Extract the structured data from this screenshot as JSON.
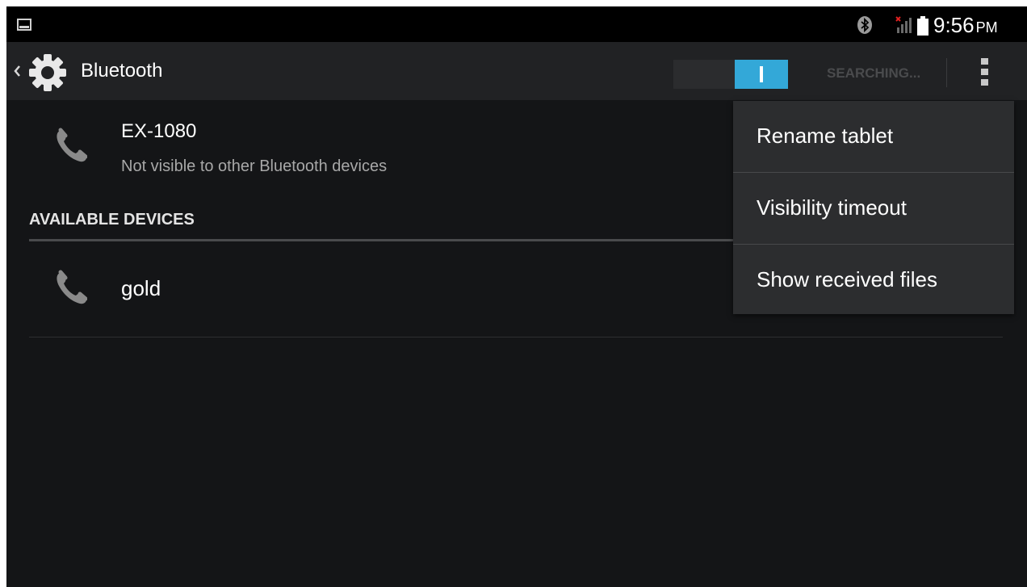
{
  "status_bar": {
    "time": "9:56",
    "ampm": "PM",
    "icons": [
      "picture-icon",
      "bluetooth-icon",
      "signal-icon",
      "battery-icon"
    ]
  },
  "action_bar": {
    "title": "Bluetooth",
    "toggle_on": true,
    "searching_label": "SEARCHING...",
    "toggle_color": "#33a8d8"
  },
  "paired_device": {
    "name": "EX-1080",
    "subtitle": "Not visible to other Bluetooth devices",
    "icon": "phone-icon"
  },
  "available": {
    "header": "AVAILABLE DEVICES",
    "devices": [
      {
        "name": "gold",
        "icon": "phone-icon"
      }
    ]
  },
  "overflow_menu": {
    "items": [
      {
        "label": "Rename tablet"
      },
      {
        "label": "Visibility timeout"
      },
      {
        "label": "Show received files"
      }
    ]
  }
}
